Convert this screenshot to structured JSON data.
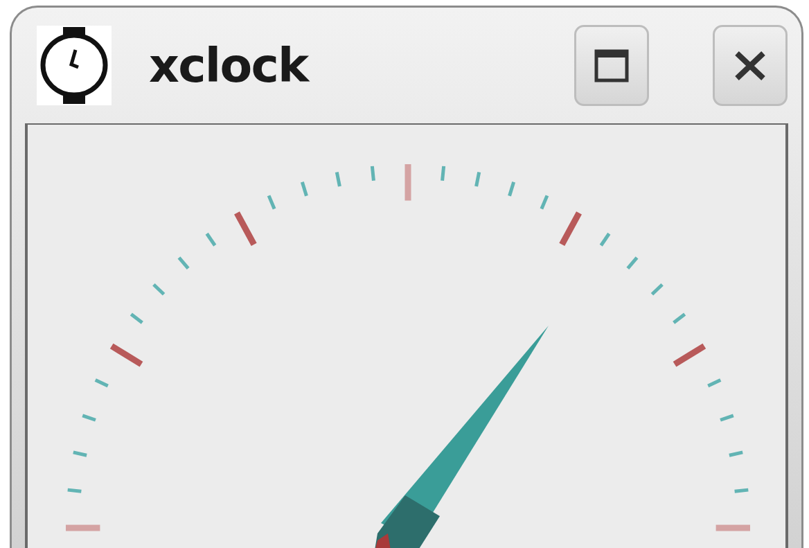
{
  "window": {
    "title": "xclock"
  }
}
